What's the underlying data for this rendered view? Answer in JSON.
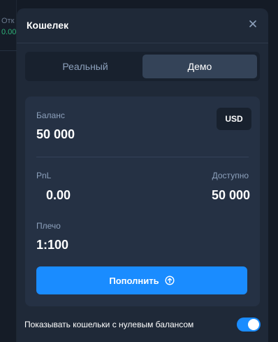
{
  "background": {
    "label_fragment": "Отк",
    "value_fragment": "0.00"
  },
  "modal": {
    "title": "Кошелек",
    "close_icon": "close-icon"
  },
  "tabs": [
    {
      "label": "Реальный",
      "active": false
    },
    {
      "label": "Демо",
      "active": true
    }
  ],
  "account": {
    "balance_label": "Баланс",
    "balance_value": "50 000",
    "currency": "USD",
    "pnl_label": "PnL",
    "pnl_value": "0.00",
    "available_label": "Доступно",
    "available_value": "50 000",
    "leverage_label": "Плечо",
    "leverage_value": "1:100"
  },
  "deposit": {
    "label": "Пополнить",
    "icon": "arrow-up-circle-icon"
  },
  "show_zero_balance": {
    "label": "Показывать кошельки с нулевым балансом",
    "enabled": true
  },
  "colors": {
    "accent": "#1a8cff",
    "modal_bg": "#1f2938",
    "card_bg": "#253144",
    "muted_text": "#8da1bc"
  }
}
